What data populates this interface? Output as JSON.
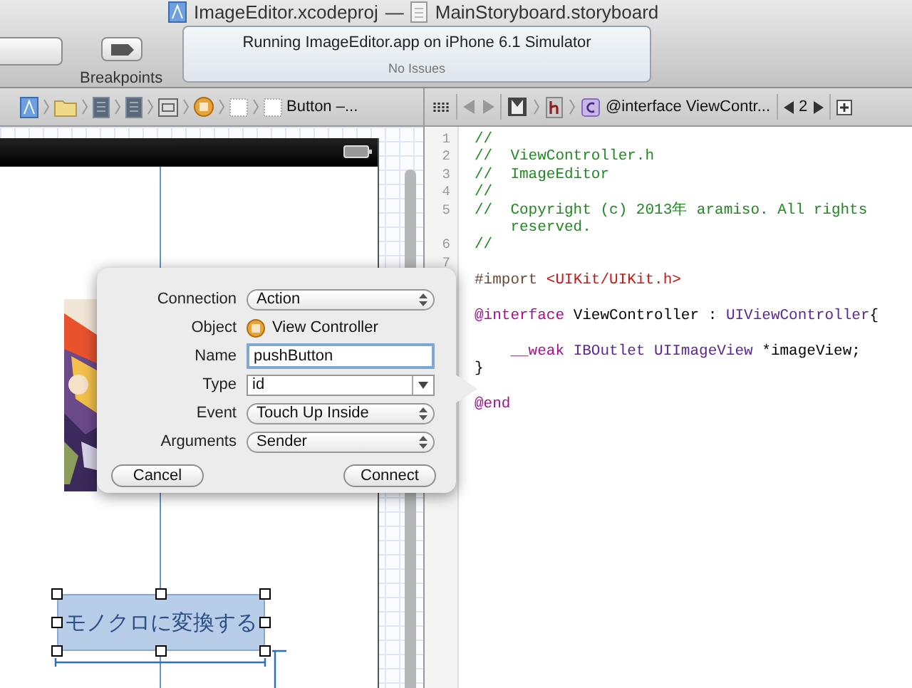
{
  "window": {
    "project": "ImageEditor.xcodeproj",
    "separator": "—",
    "file": "MainStoryboard.storyboard"
  },
  "toolbar": {
    "breakpoints_label": "Breakpoints",
    "status": "Running ImageEditor.app on iPhone 6.1 Simulator",
    "issues": "No Issues"
  },
  "jump_bar_left": {
    "last_item": "Button –..."
  },
  "jump_bar_right": {
    "symbol": "@interface ViewContr...",
    "counterpart": "2"
  },
  "canvas": {
    "button": {
      "label": "モノクロに変換する",
      "selected": true
    }
  },
  "popover": {
    "rows": [
      {
        "label": "Connection",
        "kind": "popup",
        "value": "Action"
      },
      {
        "label": "Object",
        "kind": "object",
        "value": "View Controller"
      },
      {
        "label": "Name",
        "kind": "field",
        "value": "pushButton"
      },
      {
        "label": "Type",
        "kind": "combo",
        "value": "id"
      },
      {
        "label": "Event",
        "kind": "popup",
        "value": "Touch Up Inside"
      },
      {
        "label": "Arguments",
        "kind": "popup",
        "value": "Sender"
      }
    ],
    "buttons": [
      "Cancel",
      "Connect"
    ]
  },
  "editor": {
    "lines": [
      {
        "number": "1",
        "tokens": [
          {
            "kind": "comment",
            "text": "//"
          }
        ]
      },
      {
        "number": "2",
        "tokens": [
          {
            "kind": "comment",
            "text": "//  ViewController.h"
          }
        ]
      },
      {
        "number": "3",
        "tokens": [
          {
            "kind": "comment",
            "text": "//  ImageEditor"
          }
        ]
      },
      {
        "number": "4",
        "tokens": [
          {
            "kind": "comment",
            "text": "//"
          }
        ]
      },
      {
        "number": "5",
        "tokens": [
          {
            "kind": "comment",
            "text": "//  Copyright (c) 2013年 aramiso. All rights reserved."
          }
        ]
      },
      {
        "number": "6",
        "tokens": [
          {
            "kind": "comment",
            "text": "//"
          }
        ]
      },
      {
        "number": "7"
      },
      {
        "space_after": true,
        "tokens": [
          {
            "kind": "preprocessor",
            "text": "#import "
          },
          {
            "kind": "string",
            "text": "<UIKit/UIKit.h>"
          }
        ]
      },
      {
        "space_after": true,
        "tokens": [
          {
            "kind": "keyword",
            "text": "@interface"
          },
          {
            "kind": "plain",
            "text": " ViewController : "
          },
          {
            "kind": "type",
            "text": "UIViewController"
          },
          {
            "kind": "plain",
            "text": "{"
          }
        ]
      },
      {
        "indented": true,
        "tokens": [
          {
            "kind": "keyword",
            "text": "__weak"
          },
          {
            "kind": "type",
            "text": " IBOutlet UIImageView"
          },
          {
            "kind": "plain",
            "text": " *imageView;"
          }
        ]
      },
      {
        "space_after": true,
        "tokens": [
          {
            "kind": "plain",
            "text": "}"
          }
        ]
      },
      {
        "tokens": [
          {
            "kind": "keyword",
            "text": "@end"
          }
        ]
      }
    ]
  }
}
